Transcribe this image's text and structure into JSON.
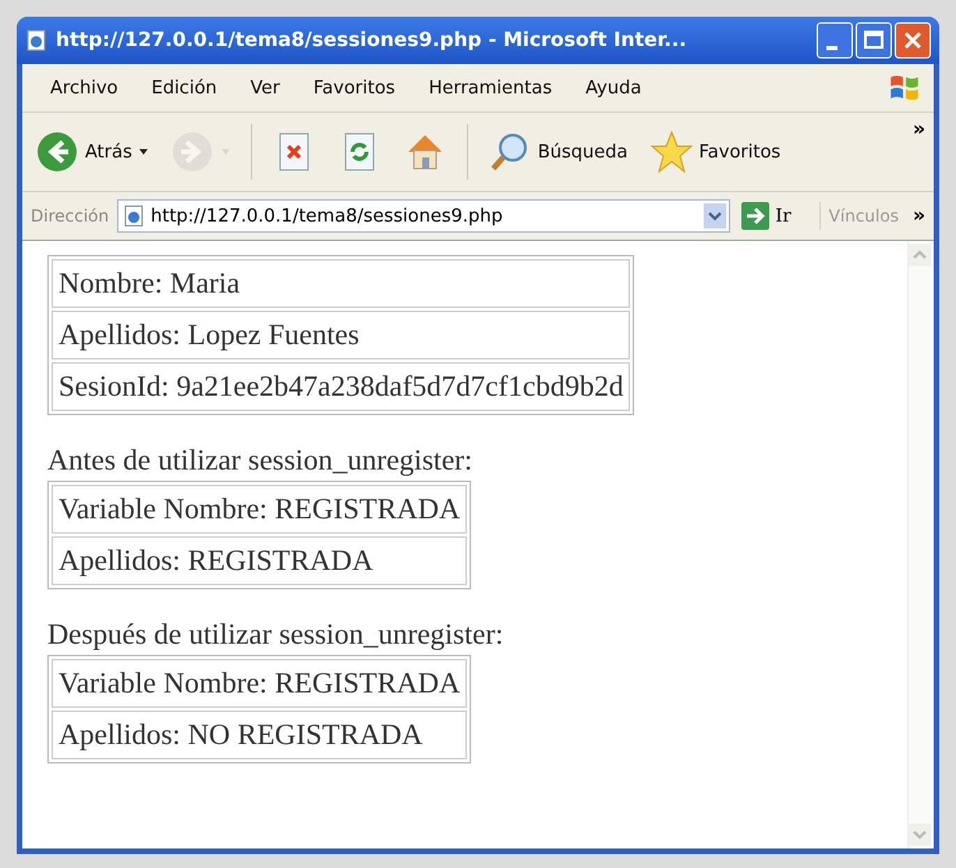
{
  "window": {
    "title": "http://127.0.0.1/tema8/sessiones9.php - Microsoft Inter..."
  },
  "menu": [
    "Archivo",
    "Edición",
    "Ver",
    "Favoritos",
    "Herramientas",
    "Ayuda"
  ],
  "toolbar": [
    {
      "kind": "back",
      "label": "Atrás",
      "disabled": false
    },
    {
      "kind": "forward",
      "disabled": true
    },
    {
      "kind": "stop",
      "disabled": false
    },
    {
      "kind": "refresh",
      "disabled": false
    },
    {
      "kind": "home",
      "disabled": false
    },
    {
      "kind": "search",
      "label": "Búsqueda",
      "disabled": false
    },
    {
      "kind": "favorites",
      "label": "Favoritos",
      "disabled": false
    }
  ],
  "chevron": "»",
  "address_bar": {
    "label": "Dirección",
    "url": "http://127.0.0.1/tema8/sessiones9.php",
    "go": "Ir",
    "links": "Vínculos",
    "chevron": "»"
  },
  "sections": [
    {
      "rows": [
        "Nombre: Maria",
        "Apellidos: Lopez Fuentes",
        "SesionId: 9a21ee2b47a238daf5d7d7cf1cbd9b2d"
      ]
    },
    {
      "heading": "Antes de utilizar session_unregister:",
      "rows": [
        "Variable Nombre: REGISTRADA",
        "Apellidos: REGISTRADA"
      ]
    },
    {
      "heading": "Después de utilizar session_unregister:",
      "rows": [
        "Variable Nombre: REGISTRADA",
        "Apellidos: NO REGISTRADA"
      ]
    }
  ]
}
